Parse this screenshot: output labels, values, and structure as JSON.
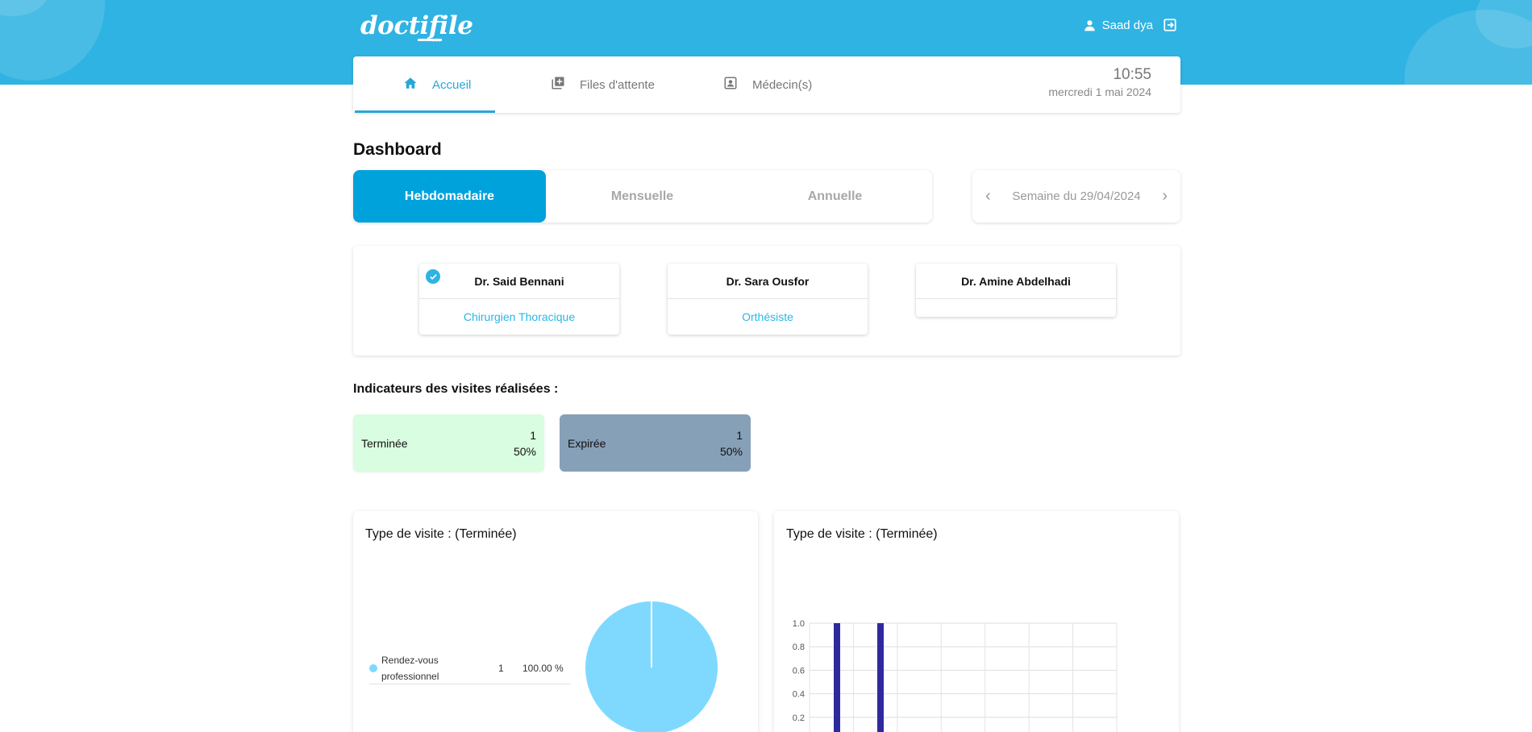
{
  "brand": {
    "logo": "doctifile"
  },
  "user": {
    "name": "Saad dya"
  },
  "nav": {
    "tabs": [
      {
        "label": "Accueil",
        "active": true,
        "icon": "home-icon"
      },
      {
        "label": "Files d'attente",
        "active": false,
        "icon": "queue-icon"
      },
      {
        "label": "Médecin(s)",
        "active": false,
        "icon": "doctor-badge-icon"
      }
    ],
    "time": "10:55",
    "date": "mercredi 1 mai 2024"
  },
  "dashboard": {
    "title": "Dashboard",
    "periods": [
      "Hebdomadaire",
      "Mensuelle",
      "Annuelle"
    ],
    "active_period": "Hebdomadaire",
    "week_label": "Semaine du 29/04/2024"
  },
  "doctors": [
    {
      "name": "Dr. Said Bennani",
      "specialty": "Chirurgien Thoracique",
      "selected": true
    },
    {
      "name": "Dr. Sara Ousfor",
      "specialty": "Orthésiste",
      "selected": false
    },
    {
      "name": "Dr. Amine Abdelhadi",
      "specialty": "",
      "selected": false
    }
  ],
  "indicators": {
    "title": "Indicateurs des visites réalisées :",
    "cards": [
      {
        "label": "Terminée",
        "count": "1",
        "percent": "50%",
        "color": "#d9fde0"
      },
      {
        "label": "Expirée",
        "count": "1",
        "percent": "50%",
        "color": "#86a0b8"
      }
    ]
  },
  "panels": {
    "pie_title": "Type de visite : (Terminée)",
    "bar_title": "Type de visite : (Terminée)",
    "legend": {
      "label_line1": "Rendez-vous",
      "label_line2": "professionnel",
      "count": "1",
      "percent": "100.00 %"
    }
  },
  "chart_data": [
    {
      "type": "pie",
      "title": "Type de visite : (Terminée)",
      "categories": [
        "Rendez-vous professionnel"
      ],
      "values": [
        1
      ],
      "colors": [
        "#7fd9ff"
      ]
    },
    {
      "type": "bar",
      "title": "Type de visite : (Terminée)",
      "yticks": [
        "1.0",
        "0.8",
        "0.6",
        "0.4",
        "0.2"
      ],
      "ylim": [
        0,
        1
      ],
      "values": [
        1,
        1
      ],
      "colors": [
        "#2e2a9e"
      ],
      "grid": true
    }
  ]
}
